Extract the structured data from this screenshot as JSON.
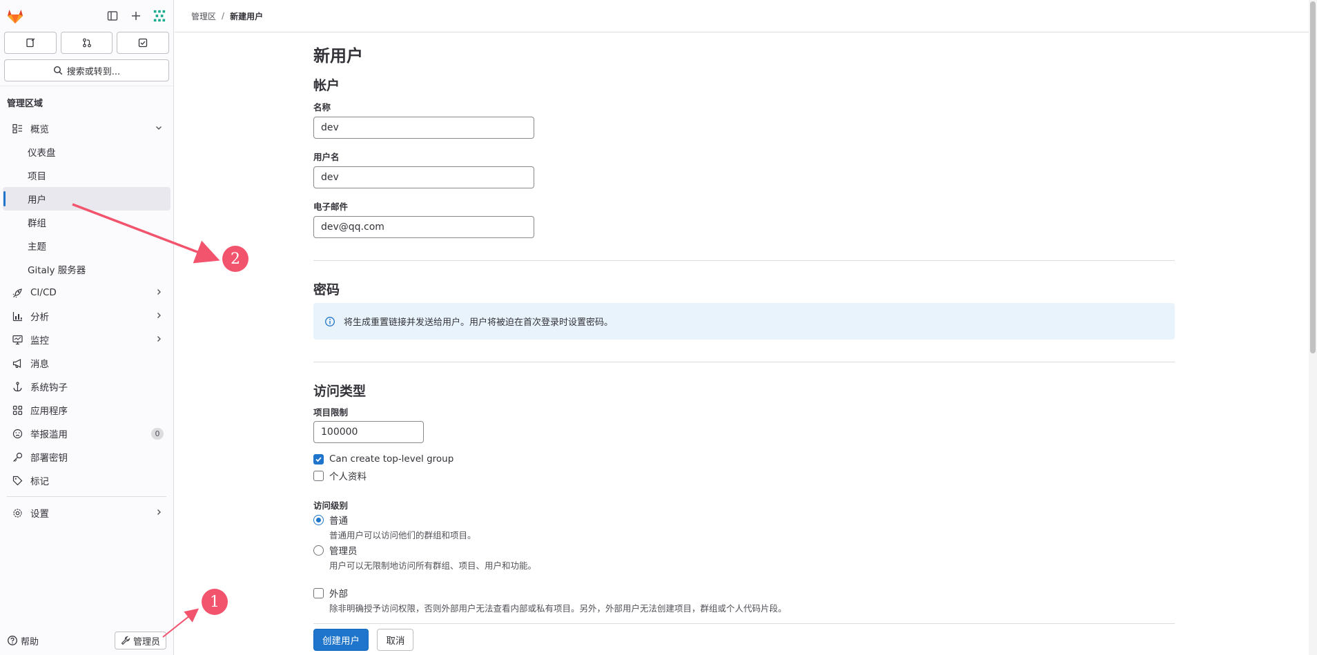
{
  "sidebar": {
    "admin_area_title": "管理区域",
    "search_label": "搜索或转到...",
    "overview": {
      "label": "概览",
      "items": [
        "仪表盘",
        "项目",
        "用户",
        "群组",
        "主题",
        "Gitaly 服务器"
      ]
    },
    "nav": [
      {
        "label": "CI/CD",
        "icon": "rocket-icon",
        "chevron": true
      },
      {
        "label": "分析",
        "icon": "chart-icon",
        "chevron": true
      },
      {
        "label": "监控",
        "icon": "monitor-icon",
        "chevron": true
      },
      {
        "label": "消息",
        "icon": "megaphone-icon",
        "chevron": false
      },
      {
        "label": "系统钩子",
        "icon": "anchor-icon",
        "chevron": false
      },
      {
        "label": "应用程序",
        "icon": "apps-icon",
        "chevron": false
      },
      {
        "label": "举报滥用",
        "icon": "flag-face-icon",
        "chevron": false,
        "badge": "0"
      },
      {
        "label": "部署密钥",
        "icon": "key-icon",
        "chevron": false
      },
      {
        "label": "标记",
        "icon": "label-icon",
        "chevron": false
      }
    ],
    "settings_label": "设置",
    "help_label": "帮助",
    "admin_label": "管理员"
  },
  "breadcrumb": {
    "root": "管理区",
    "current": "新建用户"
  },
  "form": {
    "page_title": "新用户",
    "account_heading": "帐户",
    "name_label": "名称",
    "name_value": "dev",
    "username_label": "用户名",
    "username_value": "dev",
    "email_label": "电子邮件",
    "email_value": "dev@qq.com",
    "password_heading": "密码",
    "password_info": "将生成重置链接并发送给用户。用户将被迫在首次登录时设置密码。",
    "access_heading": "访问类型",
    "projects_limit_label": "项目限制",
    "projects_limit_value": "100000",
    "can_create_group_label": "Can create top-level group",
    "profile_label": "个人资料",
    "access_level_label": "访问级别",
    "regular_label": "普通",
    "regular_help": "普通用户可以访问他们的群组和项目。",
    "admin_label": "管理员",
    "admin_help": "用户可以无限制地访问所有群组、项目、用户和功能。",
    "external_label": "外部",
    "external_help": "除非明确授予访问权限，否则外部用户无法查看内部或私有项目。另外，外部用户无法创建项目，群组或个人代码片段。",
    "create_button": "创建用户",
    "cancel_button": "取消"
  },
  "annotations": [
    "1",
    "2"
  ],
  "colors": {
    "accent": "#1f75cb",
    "annotation": "#f2546d",
    "info_bg": "#e9f3fc"
  }
}
